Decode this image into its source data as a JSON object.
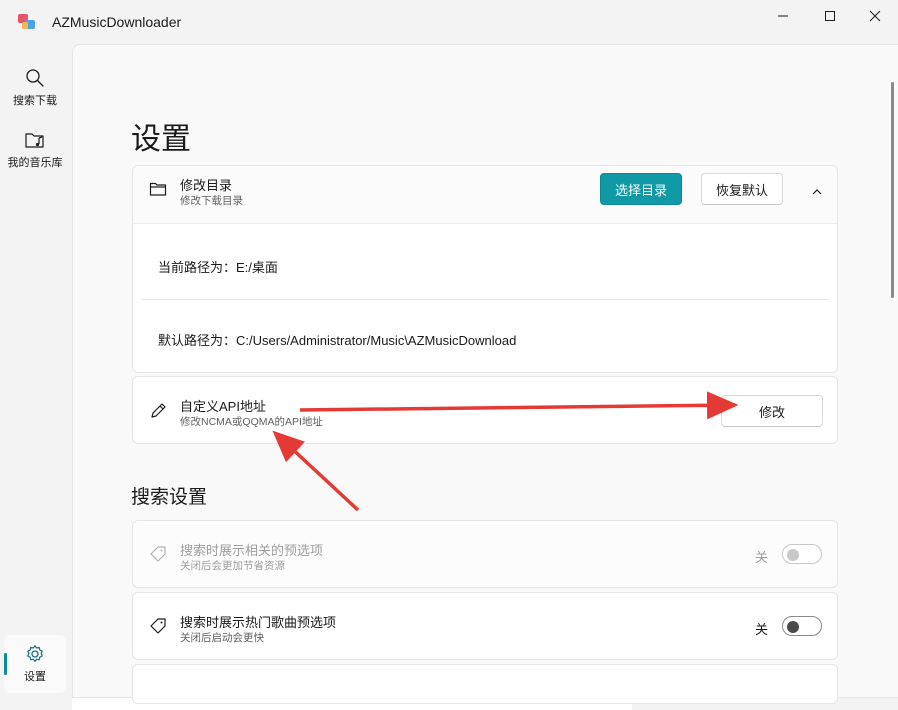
{
  "app": {
    "title": "AZMusicDownloader",
    "logo_icon": "app-logo-icon"
  },
  "window_controls": [
    "minimize-icon",
    "maximize-icon",
    "close-icon"
  ],
  "sidebar": {
    "items": [
      {
        "label": "搜索下载",
        "icon": "search-icon"
      },
      {
        "label": "我的音乐库",
        "icon": "music-folder-icon"
      }
    ],
    "footer_item": {
      "label": "设置",
      "icon": "gear-icon",
      "selected": true
    }
  },
  "page": {
    "title": "设置"
  },
  "download_dir": {
    "title": "修改目录",
    "subtitle": "修改下载目录",
    "select_button": "选择目录",
    "reset_button": "恢复默认",
    "expanded": true,
    "current_path_label": "当前路径为：",
    "current_path_value": "E:/桌面",
    "default_path_label": "默认路径为：",
    "default_path_value": "C:/Users/Administrator/Music\\AZMusicDownload"
  },
  "custom_api": {
    "title": "自定义API地址",
    "subtitle": "修改NCMA或QQMA的API地址",
    "button": "修改"
  },
  "search_settings": {
    "section_title": "搜索设置",
    "items": [
      {
        "title": "搜索时展示相关的预选项",
        "subtitle": "关闭后会更加节省资源",
        "state_label": "关",
        "enabled": false,
        "on": false
      },
      {
        "title": "搜索时展示热门歌曲预选项",
        "subtitle": "关闭后启动会更快",
        "state_label": "关",
        "enabled": true,
        "on": false
      }
    ]
  },
  "colors": {
    "accent": "#0f9aa5",
    "annotation_arrow": "#e53935"
  }
}
